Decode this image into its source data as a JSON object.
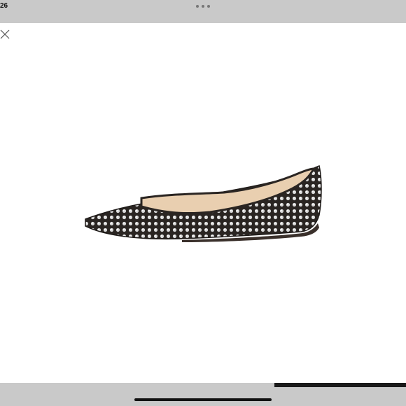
{
  "status_bar": {
    "time": "26"
  },
  "toolbar": {
    "more_icon": "more-horizontal-icon",
    "close_icon": "close-icon"
  },
  "image": {
    "subject": "product-photo"
  },
  "colors": {
    "bar": "#c9c9c9",
    "accent": "#1a1a1a"
  }
}
